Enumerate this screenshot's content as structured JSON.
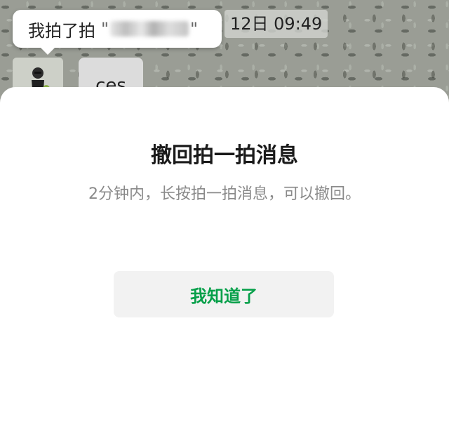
{
  "chat": {
    "pat_message": {
      "prefix": "我拍了拍",
      "open_quote": "\"",
      "close_quote": "\""
    },
    "timestamp": "12日 09:49",
    "message_text": "ces"
  },
  "dialog": {
    "title": "撤回拍一拍消息",
    "subtitle": "2分钟内，长按拍一拍消息，可以撤回。",
    "confirm_label": "我知道了",
    "confirm_color": "#07a04a"
  }
}
